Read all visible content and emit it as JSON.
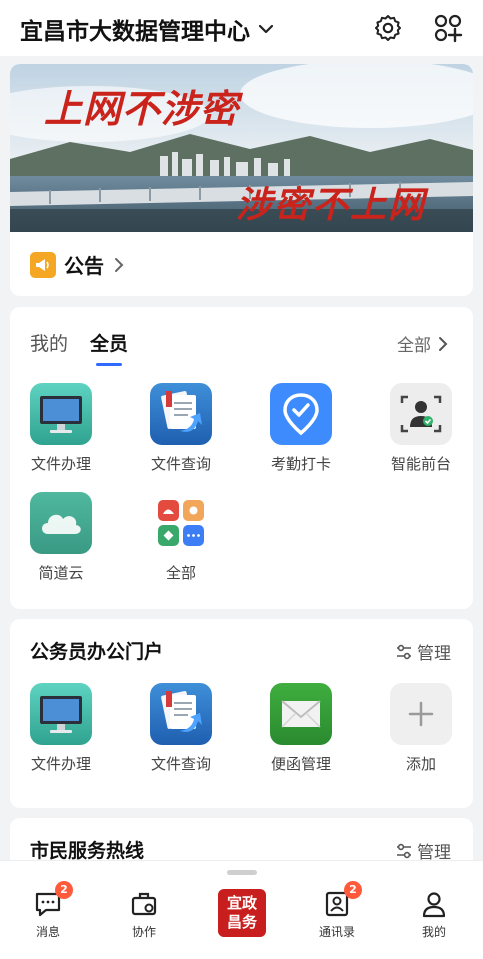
{
  "header": {
    "org_name": "宜昌市大数据管理中心"
  },
  "banner": {
    "slogan_top": "上网不涉密",
    "slogan_bottom": "涉密不上网"
  },
  "notice": {
    "label": "公告"
  },
  "my_apps": {
    "tabs": [
      {
        "label": "我的",
        "active": false
      },
      {
        "label": "全员",
        "active": true
      }
    ],
    "all_label": "全部",
    "apps": [
      {
        "label": "文件办理",
        "icon": "monitor-icon"
      },
      {
        "label": "文件查询",
        "icon": "document-search-icon"
      },
      {
        "label": "考勤打卡",
        "icon": "location-check-icon"
      },
      {
        "label": "智能前台",
        "icon": "face-scan-icon"
      },
      {
        "label": "简道云",
        "icon": "cloud-icon"
      },
      {
        "label": "全部",
        "icon": "all-apps-icon"
      }
    ]
  },
  "civil_portal": {
    "title": "公务员办公门户",
    "manage_label": "管理",
    "apps": [
      {
        "label": "文件办理",
        "icon": "monitor-icon"
      },
      {
        "label": "文件查询",
        "icon": "document-search-icon"
      },
      {
        "label": "便函管理",
        "icon": "envelope-icon"
      },
      {
        "label": "添加",
        "icon": "plus-icon"
      }
    ]
  },
  "hotline": {
    "title": "市民服务热线",
    "manage_label": "管理"
  },
  "bottom_nav": {
    "items": [
      {
        "label": "消息",
        "badge": "2"
      },
      {
        "label": "协作"
      },
      {
        "label": "宜政昌务"
      },
      {
        "label": "通讯录",
        "badge": "2"
      },
      {
        "label": "我的"
      }
    ],
    "center_logo_text": [
      "宜政",
      "昌务"
    ]
  },
  "colors": {
    "accent": "#2f6bff",
    "badge": "#ff5a3c",
    "brand_red": "#c81e1e",
    "notice_orange": "#f5a623"
  }
}
